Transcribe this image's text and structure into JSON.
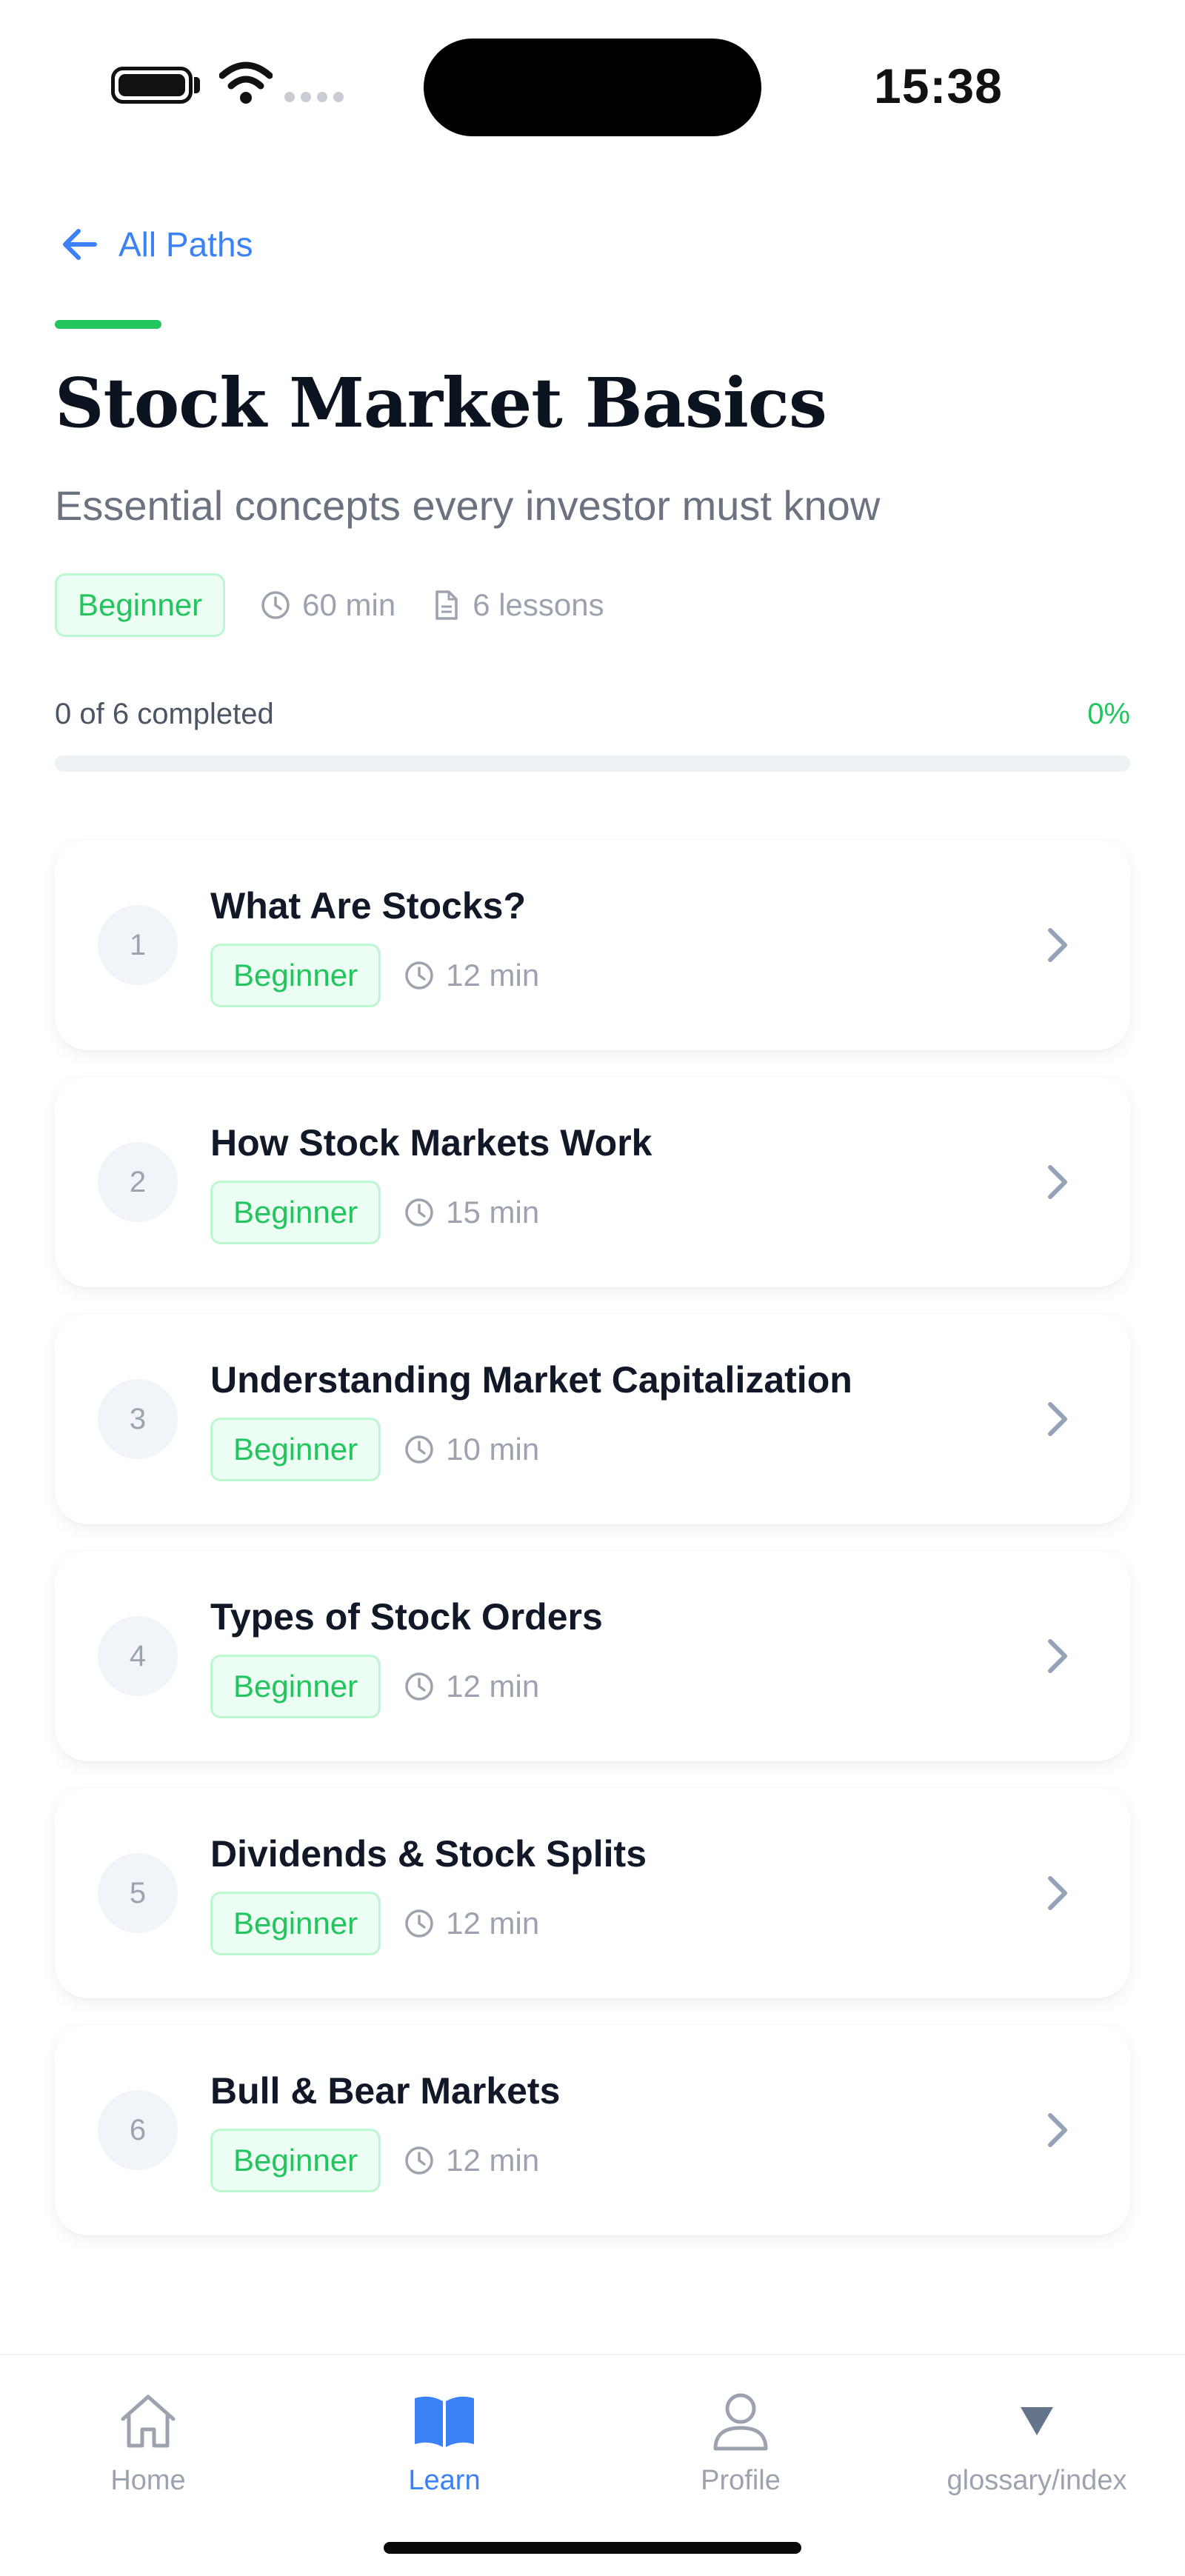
{
  "status_bar": {
    "time": "15:38"
  },
  "nav": {
    "back_label": "All Paths"
  },
  "path": {
    "title": "Stock Market Basics",
    "subtitle": "Essential concepts every investor must know",
    "level": "Beginner",
    "duration": "60 min",
    "lesson_count": "6 lessons"
  },
  "progress": {
    "label": "0 of 6 completed",
    "percent_label": "0%",
    "fraction": 0
  },
  "lessons": [
    {
      "number": "1",
      "title": "What Are Stocks?",
      "level": "Beginner",
      "duration": "12 min"
    },
    {
      "number": "2",
      "title": "How Stock Markets Work",
      "level": "Beginner",
      "duration": "15 min"
    },
    {
      "number": "3",
      "title": "Understanding Market Capitalization",
      "level": "Beginner",
      "duration": "10 min"
    },
    {
      "number": "4",
      "title": "Types of Stock Orders",
      "level": "Beginner",
      "duration": "12 min"
    },
    {
      "number": "5",
      "title": "Dividends & Stock Splits",
      "level": "Beginner",
      "duration": "12 min"
    },
    {
      "number": "6",
      "title": "Bull & Bear Markets",
      "level": "Beginner",
      "duration": "12 min"
    }
  ],
  "tabs": [
    {
      "label": "Home",
      "icon": "home-icon",
      "active": false
    },
    {
      "label": "Learn",
      "icon": "book-icon",
      "active": true
    },
    {
      "label": "Profile",
      "icon": "user-icon",
      "active": false
    },
    {
      "label": "glossary/index",
      "icon": "triangle-down-icon",
      "active": false
    }
  ],
  "colors": {
    "accent_blue": "#3b82f6",
    "accent_green": "#22c55e",
    "muted": "#9ca3af"
  }
}
